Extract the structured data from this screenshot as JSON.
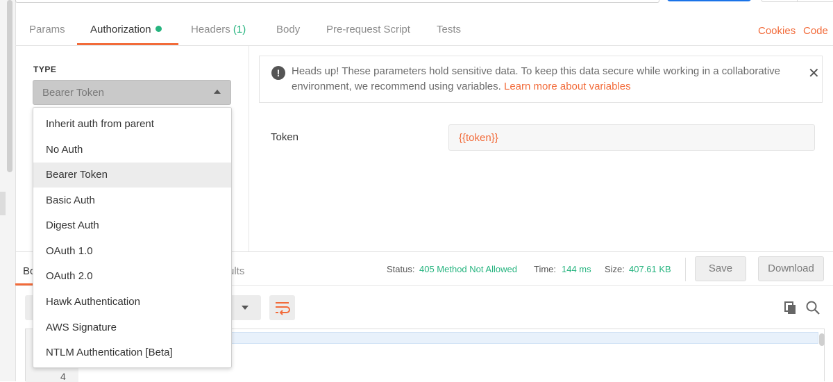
{
  "tabs": [
    {
      "label": "Params"
    },
    {
      "label": "Authorization"
    },
    {
      "label": "Headers",
      "count": "(1)"
    },
    {
      "label": "Body"
    },
    {
      "label": "Pre-request Script"
    },
    {
      "label": "Tests"
    }
  ],
  "top_links": {
    "cookies": "Cookies",
    "code": "Code"
  },
  "auth": {
    "type_label": "TYPE",
    "selected": "Bearer Token",
    "options": [
      "Inherit auth from parent",
      "No Auth",
      "Bearer Token",
      "Basic Auth",
      "Digest Auth",
      "OAuth 1.0",
      "OAuth 2.0",
      "Hawk Authentication",
      "AWS Signature",
      "NTLM Authentication [Beta]"
    ]
  },
  "alert": {
    "icon": "!",
    "text": "Heads up! These parameters hold sensitive data. To keep this data secure while working in a collaborative environment, we recommend using variables.",
    "link": "Learn more about variables",
    "close": "✕"
  },
  "token": {
    "label": "Token",
    "value": "{{token}}"
  },
  "response": {
    "tab_partial_left": "Bo",
    "tab_partial_right": "ults",
    "status_label": "Status:",
    "status_value": "405 Method Not Allowed",
    "time_label": "Time:",
    "time_value": "144 ms",
    "size_label": "Size:",
    "size_value": "407.61 KB",
    "save_label": "Save",
    "download_label": "Download"
  },
  "editor": {
    "line_number": "4"
  },
  "colors": {
    "accent": "#f26b3a",
    "success": "#26b47f"
  }
}
